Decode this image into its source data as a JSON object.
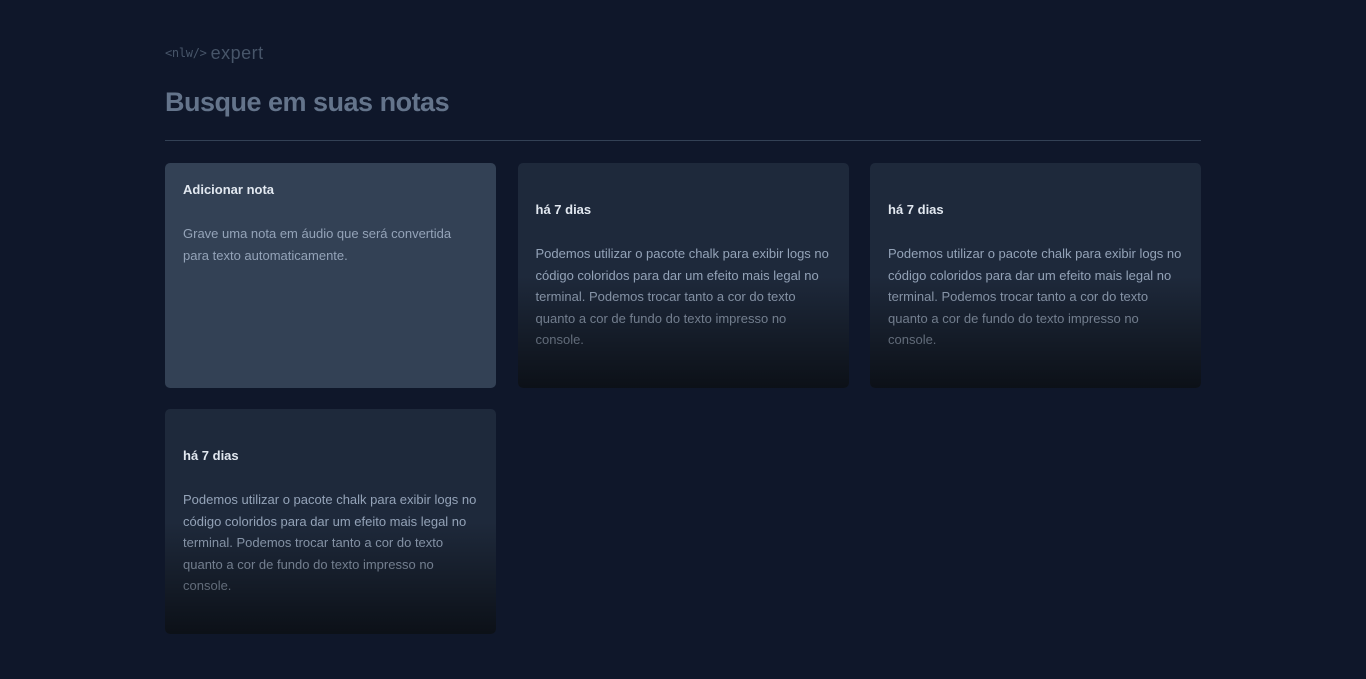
{
  "logo": {
    "tag": "<nlw/>",
    "word": "expert"
  },
  "search": {
    "placeholder": "Busque em suas notas"
  },
  "add_card": {
    "title": "Adicionar nota",
    "body": "Grave uma nota em áudio que será convertida para texto automaticamente."
  },
  "notes": [
    {
      "date": "há 7 dias",
      "content": "Podemos utilizar o pacote chalk para exibir logs no código coloridos para dar um efeito mais legal no terminal. Podemos trocar tanto a cor do texto quanto a cor de fundo do texto impresso no console."
    },
    {
      "date": "há 7 dias",
      "content": "Podemos utilizar o pacote chalk para exibir logs no código coloridos para dar um efeito mais legal no terminal. Podemos trocar tanto a cor do texto quanto a cor de fundo do texto impresso no console."
    },
    {
      "date": "há 7 dias",
      "content": "Podemos utilizar o pacote chalk para exibir logs no código coloridos para dar um efeito mais legal no terminal. Podemos trocar tanto a cor do texto quanto a cor de fundo do texto impresso no console."
    }
  ],
  "colors": {
    "background": "#0f172a",
    "card": "#1e293b",
    "add_card": "#334155",
    "divider": "#334155",
    "text_primary": "#e2e8f0",
    "text_secondary": "#94a3b8",
    "logo": "#475569"
  }
}
